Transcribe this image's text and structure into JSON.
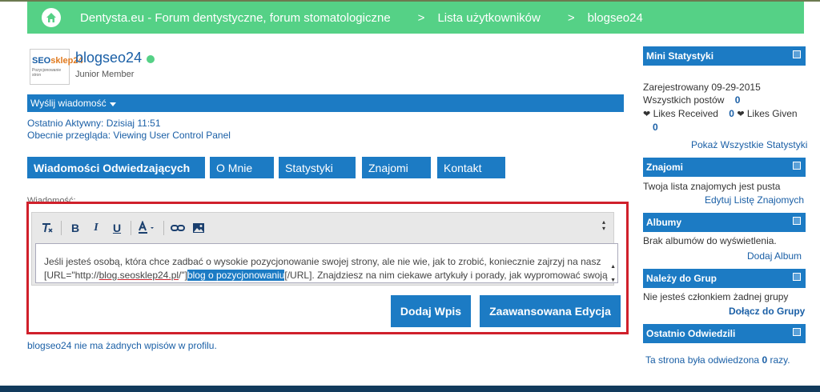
{
  "breadcrumb": {
    "items": [
      "Dentysta.eu - Forum dentystyczne, forum stomatologiczne",
      "Lista użytkowników",
      "blogseo24"
    ],
    "separator": ">"
  },
  "profile": {
    "avatar_text_seo": "SEO",
    "avatar_text_sklep": "sklep24",
    "avatar_tagline": "Pozycjonowanie stron",
    "username": "blogseo24",
    "user_title": "Junior Member",
    "send_message_label": "Wyślij wiadomość",
    "last_active": "Ostatnio Aktywny: Dzisiaj 11:51",
    "currently_viewing": "Obecnie przegląda: Viewing User Control Panel"
  },
  "tabs": [
    {
      "label": "Wiadomości Odwiedzających"
    },
    {
      "label": "O Mnie"
    },
    {
      "label": "Statystyki"
    },
    {
      "label": "Znajomi"
    },
    {
      "label": "Kontakt"
    }
  ],
  "editor": {
    "label": "Wiadomość:",
    "text_before": "Jeśli jesteś osobą, która chce zadbać o wysokie pozycjonowanie swojej strony, ale nie wie, jak to zrobić, koniecznie zajrzyj na nasz",
    "text_url_prefix": "[URL=\"http://",
    "text_url_domain": "blog.seosklep24.pl",
    "text_url_suffix": "/\"]",
    "text_highlight": "blog o pozycjonowaniu",
    "text_after": "[/URL]. Znajdziesz na nim ciekawe artykuły i porady, jak wypromować swoją",
    "submit_label": "Dodaj Wpis",
    "advanced_label": "Zaawansowana Edycja"
  },
  "no_posts": "blogseo24 nie ma żadnych wpisów w profilu.",
  "sidebar": {
    "mini_stats": {
      "title": "Mini Statystyki",
      "registered": "Zarejestrowany 09-29-2015",
      "posts_label": "Wszystkich postów",
      "posts_value": "0",
      "likes_received_label": "Likes Received",
      "likes_received_value": "0",
      "likes_given_label": "Likes Given",
      "likes_given_value": "0",
      "show_all": "Pokaż Wszystkie Statystyki"
    },
    "friends": {
      "title": "Znajomi",
      "text": "Twoja lista znajomych jest pusta",
      "link": "Edytuj Listę Znajomych"
    },
    "albums": {
      "title": "Albumy",
      "text": "Brak albumów do wyświetlenia.",
      "link": "Dodaj Album"
    },
    "groups": {
      "title": "Należy do Grup",
      "text": "Nie jesteś członkiem żadnej grupy",
      "link": "Dołącz do Grupy"
    },
    "visitors": {
      "title": "Ostatnio Odwiedzili",
      "text_before": "Ta strona była odwiedzona",
      "count": "0",
      "text_after": "razy."
    }
  },
  "colors": {
    "breadcrumb_bg": "#55d186",
    "primary_blue": "#1c7bc4",
    "highlight_red": "#d0202b",
    "footer": "#123a5c"
  }
}
